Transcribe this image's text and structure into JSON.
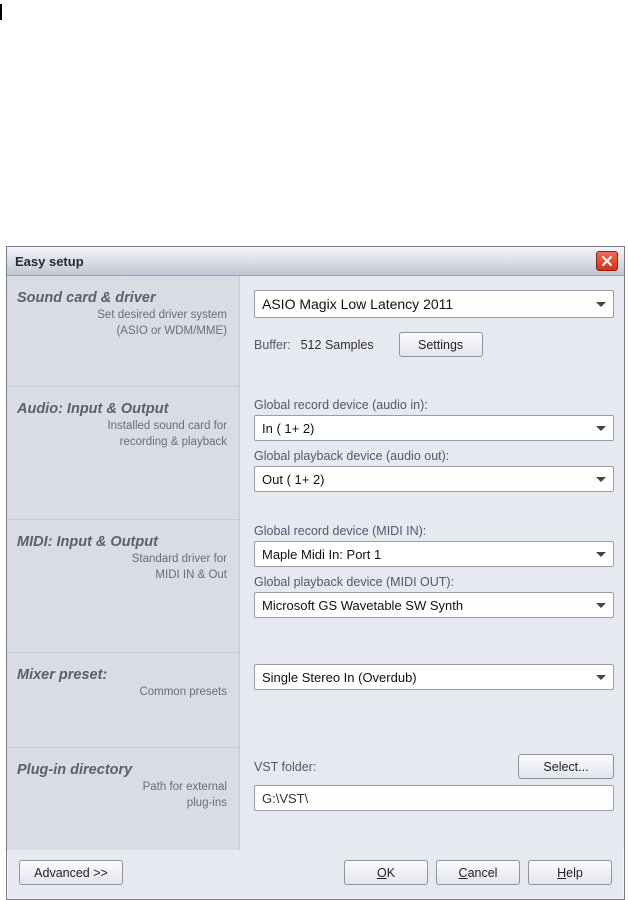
{
  "window": {
    "title": "Easy setup"
  },
  "sections": {
    "sound": {
      "title": "Sound card & driver",
      "sub": "Set desired driver system\n(ASIO or WDM/MME)"
    },
    "audio": {
      "title": "Audio: Input & Output",
      "sub": "Installed sound card for\nrecording & playback"
    },
    "midi": {
      "title": "MIDI: Input & Output",
      "sub": "Standard driver for\nMIDI IN & Out"
    },
    "mixer": {
      "title": "Mixer preset:",
      "sub": "Common presets"
    },
    "plugin": {
      "title": "Plug-in directory",
      "sub": "Path for external\nplug-ins"
    }
  },
  "sound": {
    "driver": "ASIO Magix Low Latency 2011",
    "buffer_label": "Buffer:",
    "buffer_value": "512 Samples",
    "settings_btn": "Settings"
  },
  "audio": {
    "rec_label": "Global record device (audio in):",
    "rec_value": "In ( 1+ 2)",
    "play_label": "Global playback device (audio out):",
    "play_value": "Out ( 1+ 2)"
  },
  "midi": {
    "rec_label": "Global record device (MIDI IN):",
    "rec_value": "Maple Midi In: Port 1",
    "play_label": "Global playback device (MIDI OUT):",
    "play_value": "Microsoft GS Wavetable SW Synth"
  },
  "mixer": {
    "value": "Single Stereo In (Overdub)"
  },
  "plugin": {
    "vst_label": "VST folder:",
    "select_btn": "Select...",
    "path": "G:\\VST\\"
  },
  "footer": {
    "advanced": "Advanced >>",
    "ok": "OK",
    "cancel": "Cancel",
    "help": "Help"
  }
}
